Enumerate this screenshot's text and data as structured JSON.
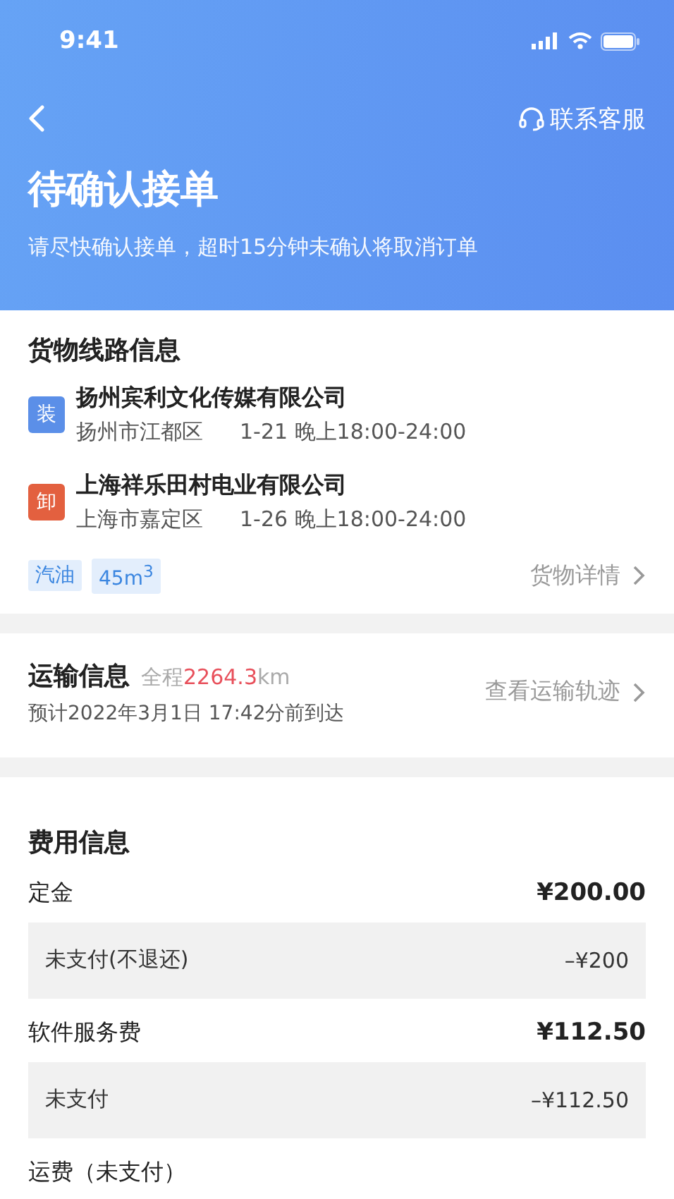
{
  "status_bar": {
    "time": "9:41"
  },
  "header": {
    "service_label": "联系客服",
    "title": "待确认接单",
    "subtitle": "请尽快确认接单，超时15分钟未确认将取消订单"
  },
  "route": {
    "title": "货物线路信息",
    "stops": [
      {
        "tag": "装",
        "color": "#5b8fe8",
        "company": "扬州宾利文化传媒有限公司",
        "district": "扬州市江都区",
        "time": "1-21 晚上18:00-24:00"
      },
      {
        "tag": "卸",
        "color": "#e3603f",
        "company": "上海祥乐田村电业有限公司",
        "district": "上海市嘉定区",
        "time": "1-26 晚上18:00-24:00"
      }
    ],
    "tags": [
      "汽油",
      "45m$^{3}$"
    ],
    "details_link": "货物详情"
  },
  "transport": {
    "title": "运输信息",
    "distance_prefix": "全程",
    "distance": "2264.3",
    "distance_unit": "km",
    "eta": "预计2022年3月1日 17:42分前到达",
    "track_link": "查看运输轨迹"
  },
  "fees": {
    "title": "费用信息",
    "rows": [
      {
        "kind": "main",
        "label": "定金",
        "amount": "¥200.00"
      },
      {
        "kind": "sub",
        "label": "未支付(不退还)",
        "amount": "–¥200"
      },
      {
        "kind": "main",
        "label": "软件服务费",
        "amount": "¥112.50"
      },
      {
        "kind": "sub",
        "label": "未支付",
        "amount": "–¥112.50"
      },
      {
        "kind": "main",
        "label": "运费（未支付）"
      }
    ]
  }
}
